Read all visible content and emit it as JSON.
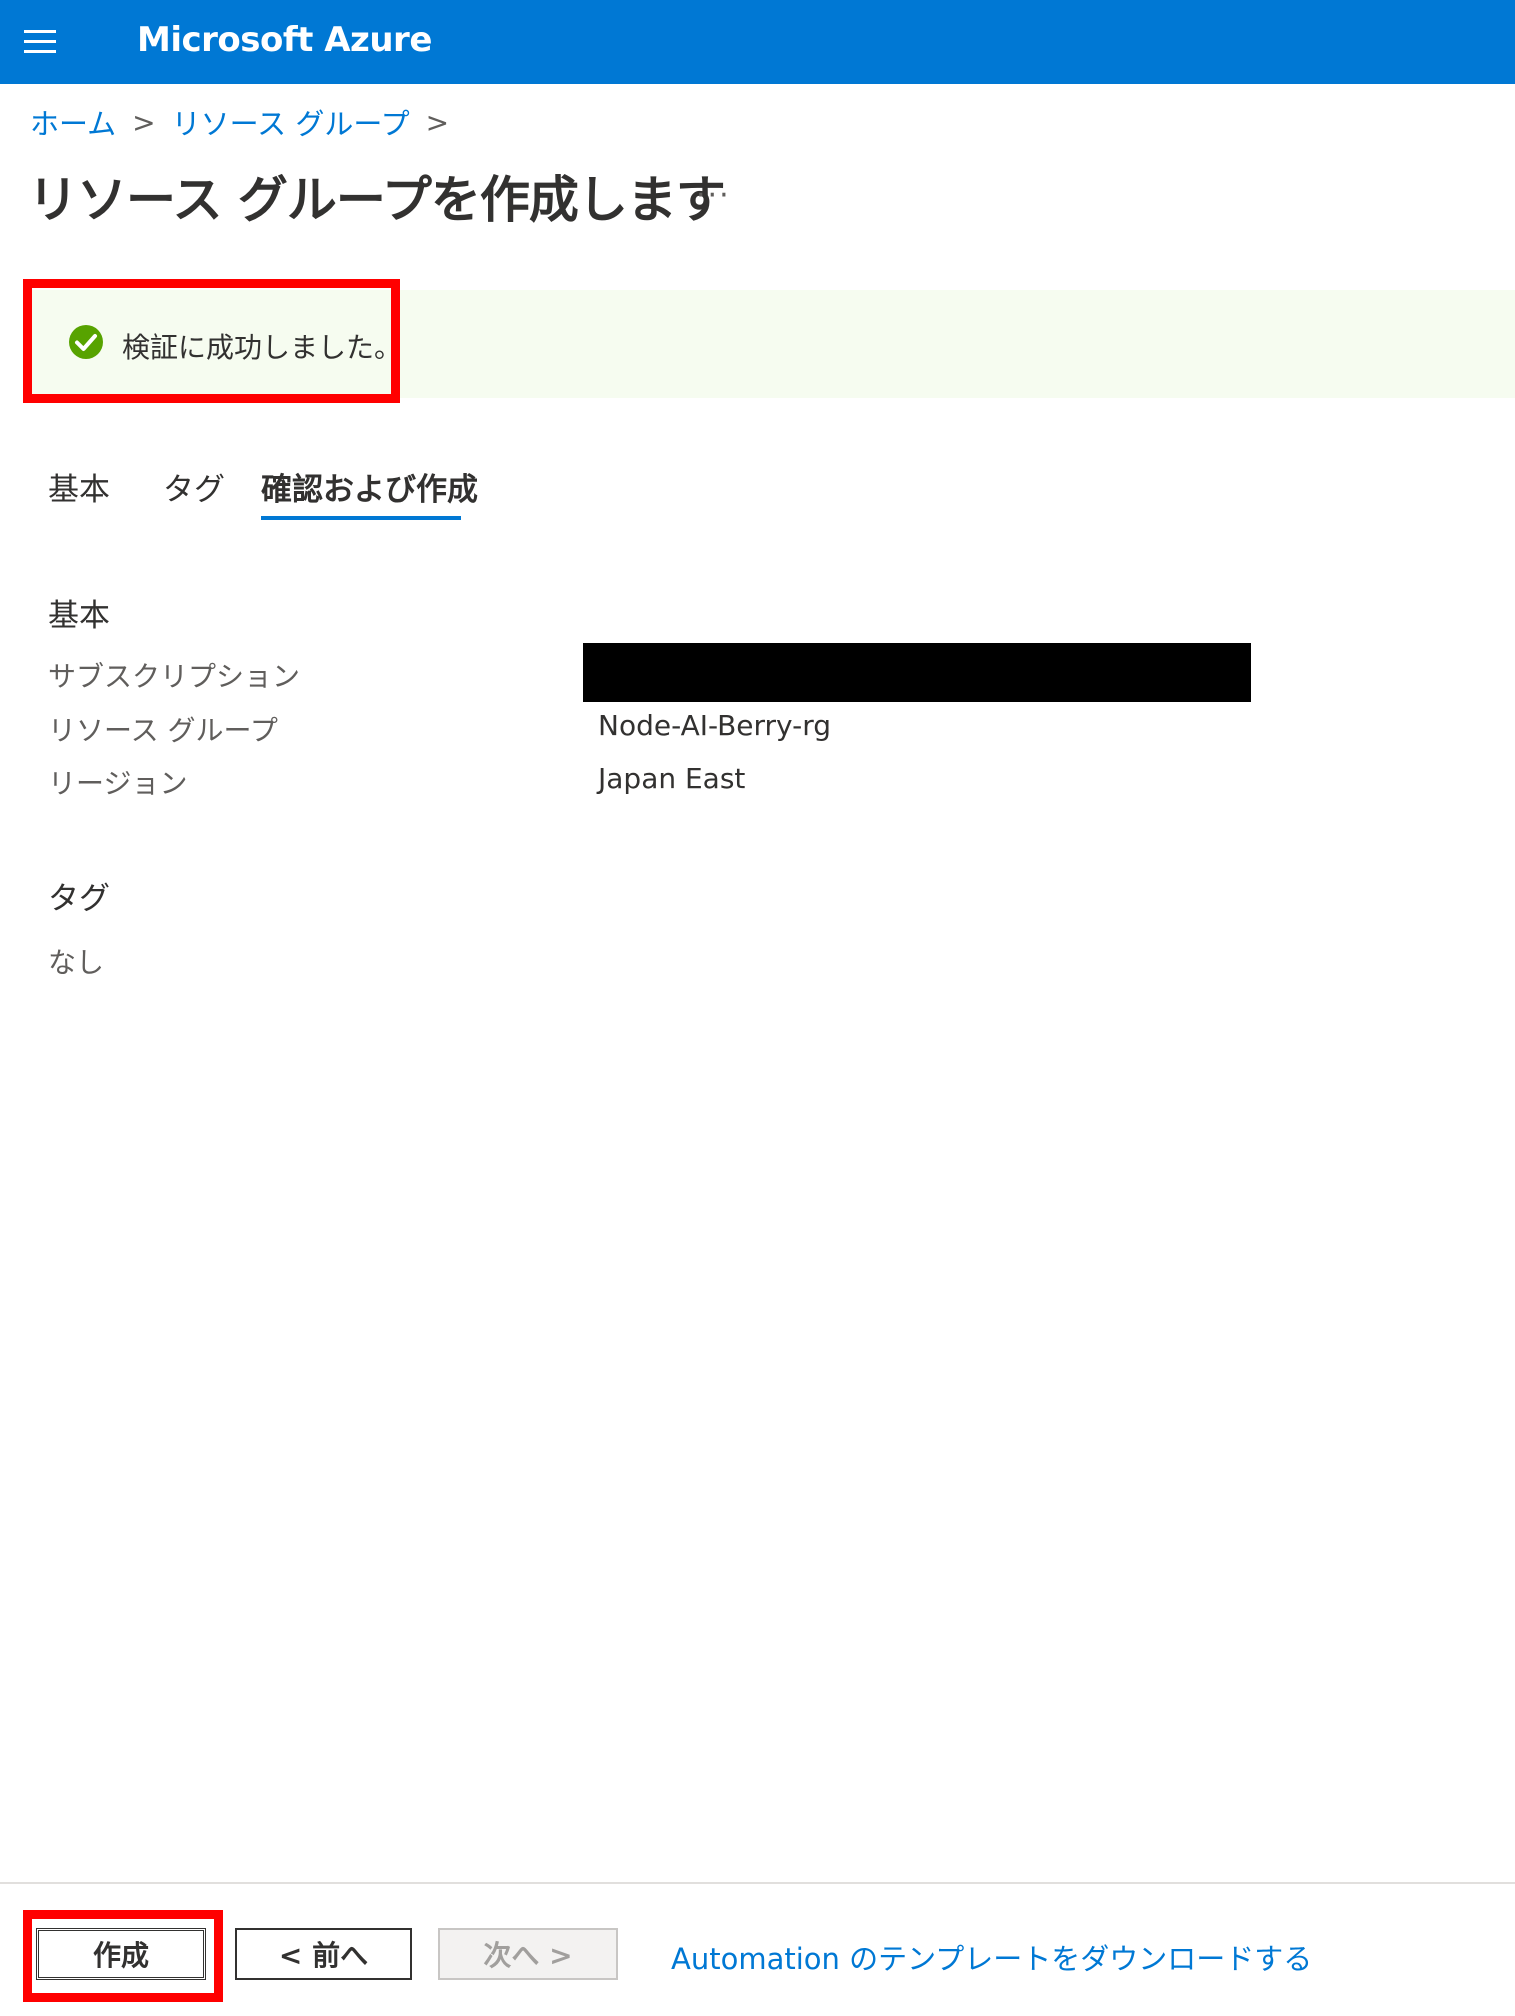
{
  "header": {
    "brand": "Microsoft Azure",
    "color": "#0078d4"
  },
  "breadcrumb": {
    "items": [
      "ホーム",
      "リソース グループ"
    ],
    "separator": ">"
  },
  "page": {
    "title": "リソース グループを作成します",
    "more": "···"
  },
  "banner": {
    "message": "検証に成功しました。",
    "status_color": "#57a300",
    "background": "#f6fcf0"
  },
  "tabs": [
    {
      "label": "基本",
      "active": false
    },
    {
      "label": "タグ",
      "active": false
    },
    {
      "label": "確認および作成",
      "active": true
    }
  ],
  "summary": {
    "basics_heading": "基本",
    "fields": [
      {
        "label": "サブスクリプション",
        "value": ""
      },
      {
        "label": "リソース グループ",
        "value": "Node-AI-Berry-rg"
      },
      {
        "label": "リージョン",
        "value": "Japan East"
      }
    ],
    "tags_heading": "タグ",
    "tags_value": "なし"
  },
  "footer": {
    "create_label": "作成",
    "prev_label": "< 前へ",
    "next_label": "次へ >",
    "download_label": "Automation のテンプレートをダウンロードする"
  },
  "annotations": {
    "highlight_color": "#ff0000"
  }
}
